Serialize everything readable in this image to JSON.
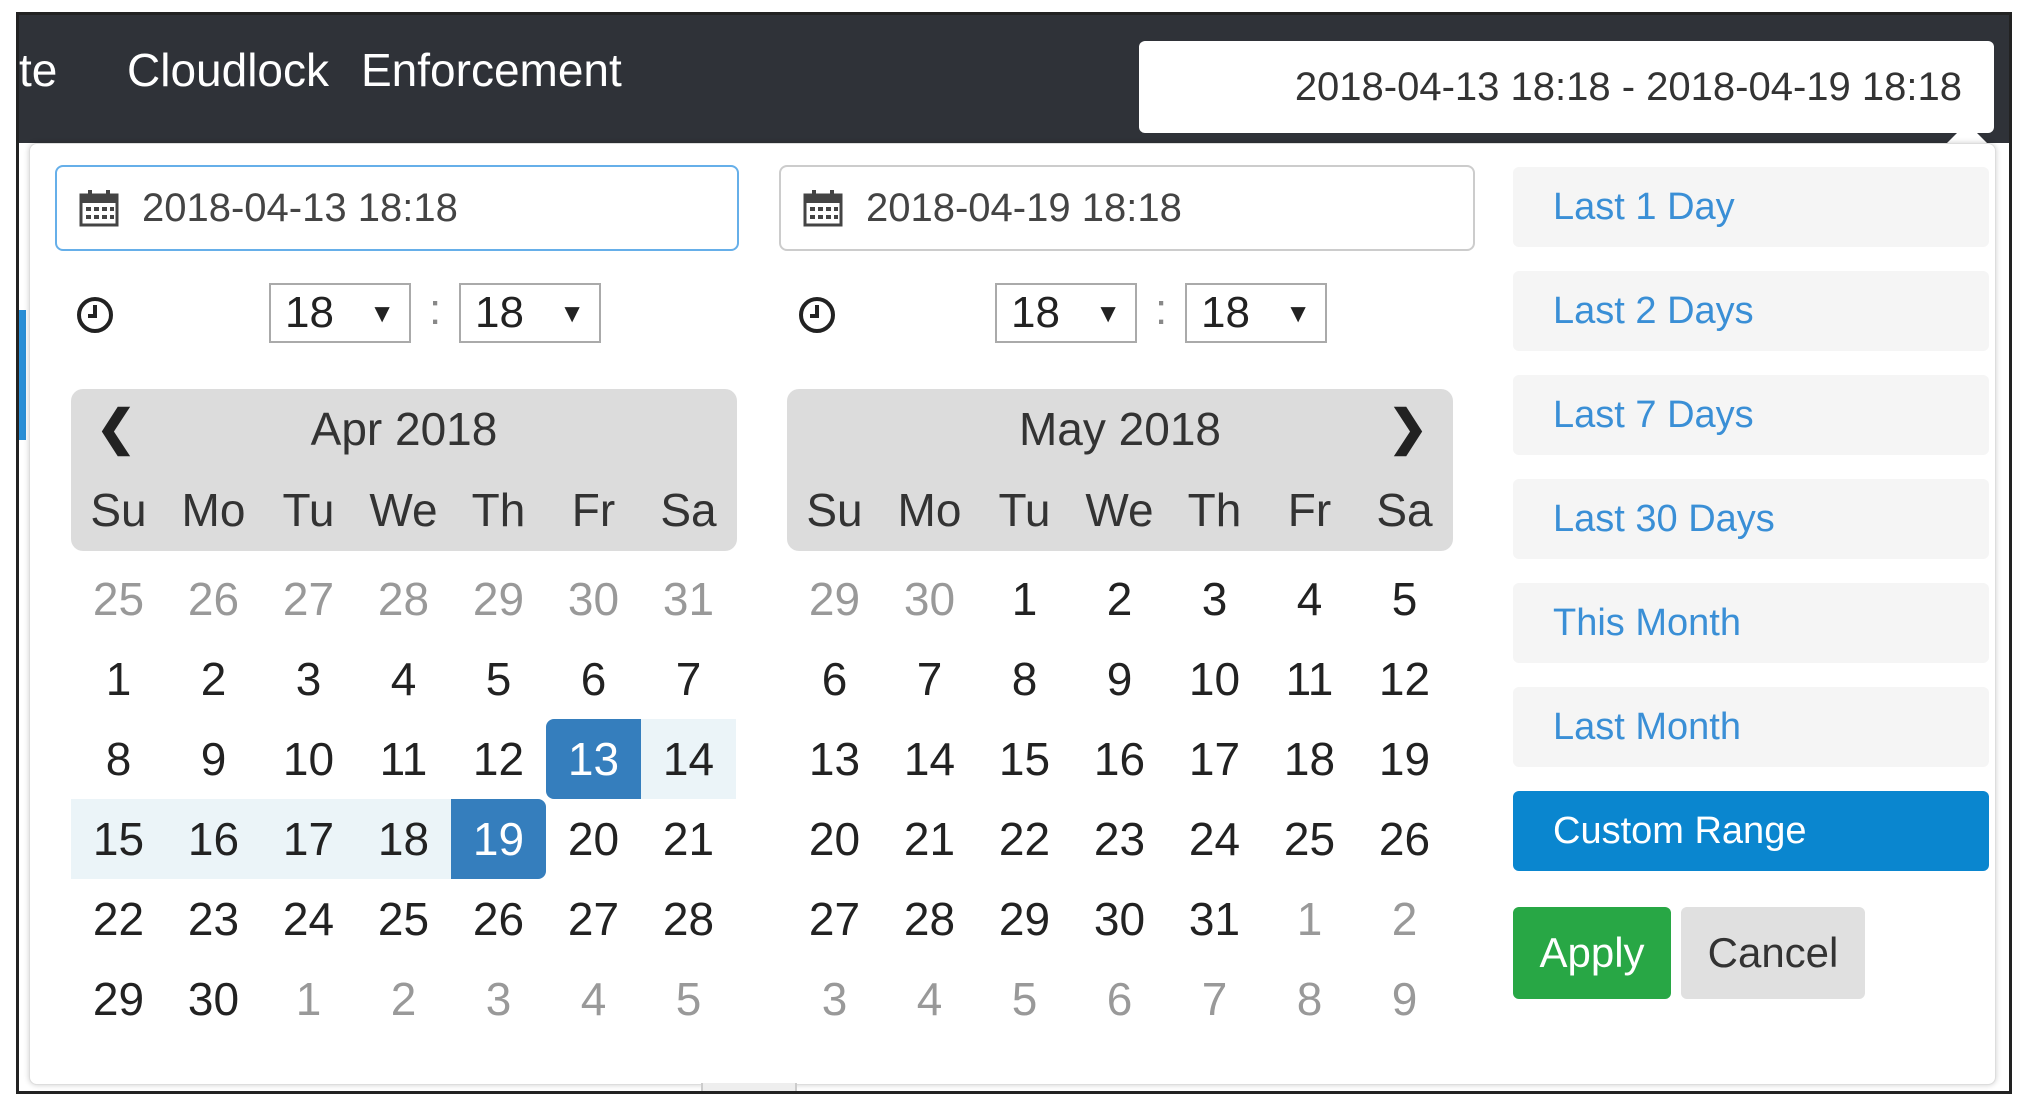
{
  "navbar": {
    "items": [
      "te",
      "Cloudlock",
      "Enforcement"
    ]
  },
  "range_display": "2018-04-13 18:18 - 2018-04-19 18:18",
  "start": {
    "value": "2018-04-13 18:18",
    "hour": "18",
    "minute": "18"
  },
  "end": {
    "value": "2018-04-19 18:18",
    "hour": "18",
    "minute": "18"
  },
  "time_separator": ":",
  "left_calendar": {
    "title": "Apr 2018",
    "weekdays": [
      "Su",
      "Mo",
      "Tu",
      "We",
      "Th",
      "Fr",
      "Sa"
    ],
    "weeks": [
      [
        "25",
        "26",
        "27",
        "28",
        "29",
        "30",
        "31"
      ],
      [
        "1",
        "2",
        "3",
        "4",
        "5",
        "6",
        "7"
      ],
      [
        "8",
        "9",
        "10",
        "11",
        "12",
        "13",
        "14"
      ],
      [
        "15",
        "16",
        "17",
        "18",
        "19",
        "20",
        "21"
      ],
      [
        "22",
        "23",
        "24",
        "25",
        "26",
        "27",
        "28"
      ],
      [
        "29",
        "30",
        "1",
        "2",
        "3",
        "4",
        "5"
      ]
    ]
  },
  "right_calendar": {
    "title": "May 2018",
    "weekdays": [
      "Su",
      "Mo",
      "Tu",
      "We",
      "Th",
      "Fr",
      "Sa"
    ],
    "weeks": [
      [
        "29",
        "30",
        "1",
        "2",
        "3",
        "4",
        "5"
      ],
      [
        "6",
        "7",
        "8",
        "9",
        "10",
        "11",
        "12"
      ],
      [
        "13",
        "14",
        "15",
        "16",
        "17",
        "18",
        "19"
      ],
      [
        "20",
        "21",
        "22",
        "23",
        "24",
        "25",
        "26"
      ],
      [
        "27",
        "28",
        "29",
        "30",
        "31",
        "1",
        "2"
      ],
      [
        "3",
        "4",
        "5",
        "6",
        "7",
        "8",
        "9"
      ]
    ]
  },
  "ranges": [
    "Last 1 Day",
    "Last 2 Days",
    "Last 7 Days",
    "Last 30 Days",
    "This Month",
    "Last Month",
    "Custom Range"
  ],
  "selected_range": "Custom Range",
  "buttons": {
    "apply": "Apply",
    "cancel": "Cancel"
  },
  "colors": {
    "accent": "#357ebd",
    "in_range": "#ebf4f8",
    "apply": "#28a745",
    "custom_range": "#0a86cf",
    "navbar": "#2f3238"
  },
  "icons": {
    "date": "calendar-icon",
    "time": "clock-icon",
    "prev": "chevron-left-icon",
    "next": "chevron-right-icon"
  }
}
